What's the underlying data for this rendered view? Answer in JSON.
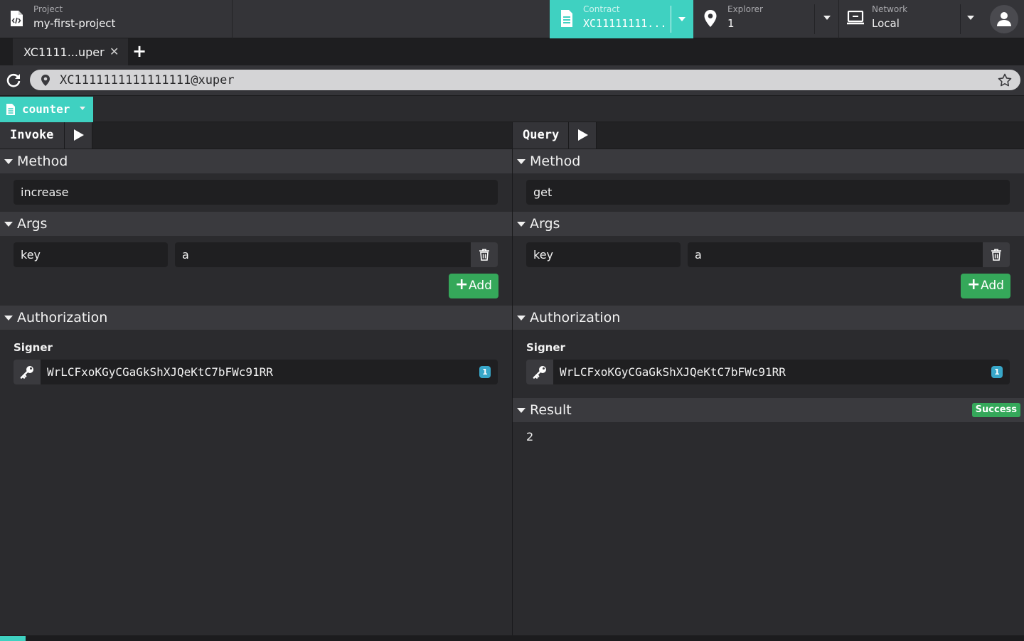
{
  "header": {
    "project": {
      "label": "Project",
      "value": "my-first-project"
    },
    "contract": {
      "label": "Contract",
      "value": "XC11111111..."
    },
    "explorer": {
      "label": "Explorer",
      "value": "1"
    },
    "network": {
      "label": "Network",
      "value": "Local"
    }
  },
  "tabs": [
    {
      "title": "XC1111...uper",
      "close": "✕"
    }
  ],
  "tab_add": "+",
  "address": {
    "value": "XC1111111111111111@xuper"
  },
  "contract_selector": {
    "label": "counter"
  },
  "invoke": {
    "title": "Invoke",
    "method_header": "Method",
    "method": "increase",
    "args_header": "Args",
    "args": [
      {
        "key": "key",
        "value": "a"
      }
    ],
    "add_label": "Add",
    "auth_header": "Authorization",
    "signer_label": "Signer",
    "signer": "WrLCFxoKGyCGaGkShXJQeKtC7bFWc91RR",
    "signer_badge": "1"
  },
  "query": {
    "title": "Query",
    "method_header": "Method",
    "method": "get",
    "args_header": "Args",
    "args": [
      {
        "key": "key",
        "value": "a"
      }
    ],
    "add_label": "Add",
    "auth_header": "Authorization",
    "signer_label": "Signer",
    "signer": "WrLCFxoKGyCGaGkShXJQeKtC7bFWc91RR",
    "signer_badge": "1",
    "result_header": "Result",
    "result_status": "Success",
    "result_value": "2"
  },
  "colors": {
    "accent": "#3fd1c1",
    "success": "#35a85a",
    "badge": "#38a7c9",
    "background": "#2b2b2e"
  },
  "icons": [
    "file-code-icon",
    "file-icon",
    "location-pin-icon",
    "monitor-icon",
    "user-icon",
    "refresh-icon",
    "star-icon",
    "play-icon",
    "trash-icon",
    "key-icon",
    "chevron-down-icon"
  ]
}
